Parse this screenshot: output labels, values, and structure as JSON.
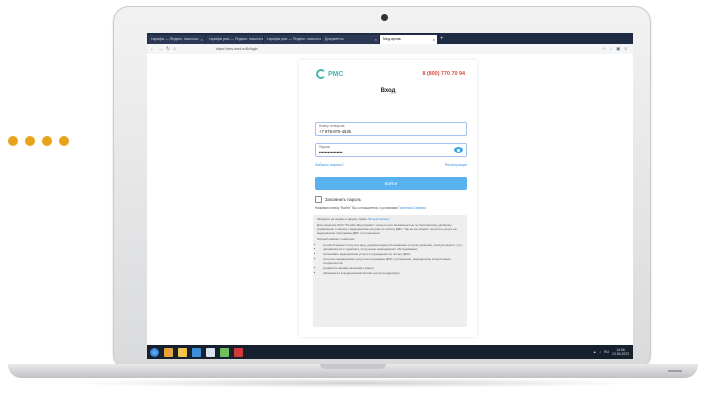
{
  "browser": {
    "tabs": [
      {
        "label": "тарифы — Яндекс: нашлось",
        "active": false
      },
      {
        "label": "тарифы рмс — Яндекс: нашлось",
        "active": false
      },
      {
        "label": "тарифы рмс — Яндекс: нашлось",
        "active": false
      },
      {
        "label": "Документы",
        "active": false
      },
      {
        "label": "Мед.архив",
        "active": true
      }
    ],
    "new_tab": "+",
    "url": "https://rms-med.ru/lk/login"
  },
  "login": {
    "logo_text": "РМС",
    "phone": "8 (800) 770 70 94",
    "title": "Вход",
    "phone_field": {
      "label": "Номер телефона",
      "value": "+7 978-875-4535"
    },
    "password_field": {
      "label": "Пароль",
      "value": "••••••••••••••••"
    },
    "forgot_link": "Забыли пароль?",
    "register_link": "Регистрация",
    "submit_label": "Войти",
    "remember_label": "Запомнить пароль",
    "consent_text": "Нажимая кнопку \"Войти\" Вы соглашаетесь с условиями",
    "consent_link": "Политики Сервиса",
    "info": {
      "heading": "Заходите на сервис в форму прямо",
      "heading_link": "Личный кабинет",
      "body": "Для клиентов ООО \"Ритейл Мед Сервис\" личного кого возможностью по бесплатному удобному управлению и записи к медицинским услугам по полису ДМС. Так же вы можете получить услуги на медицинские программы ДМС и соглашения.",
      "list_title": "Личный кабинет позволяет:",
      "items": [
        "в любой момент получить мед. документацию об оказанных услугах (анализы, консультации и т.д.);",
        "направляться к терапевту, получению медицинского обслуживания;",
        "оплачивать медицинские услуги в учреждения по полису ДМС;",
        "получать медицинские услуги на программы ДМС, соглашения, медицинские консультации специалистов;",
        "управлять своими записями к врачу;",
        "обращаться в медицинский контакт-центр (поддержку)."
      ]
    }
  },
  "help_button": "Помощь",
  "taskbar": {
    "tray_lang": "RU",
    "time": "14:56",
    "date": "13.06.2023"
  },
  "colors": {
    "accent": "#58b2ef",
    "brand_teal": "#45b8b3",
    "phone_red": "#e0463a",
    "dots": "#e8a31c"
  }
}
